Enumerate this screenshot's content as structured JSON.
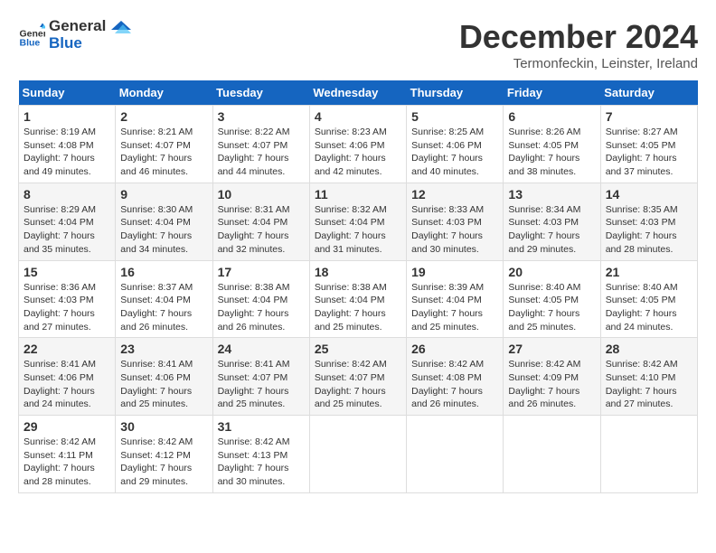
{
  "logo": {
    "general": "General",
    "blue": "Blue"
  },
  "title": "December 2024",
  "location": "Termonfeckin, Leinster, Ireland",
  "days_of_week": [
    "Sunday",
    "Monday",
    "Tuesday",
    "Wednesday",
    "Thursday",
    "Friday",
    "Saturday"
  ],
  "weeks": [
    [
      {
        "day": "1",
        "sunrise": "8:19 AM",
        "sunset": "4:08 PM",
        "daylight": "7 hours and 49 minutes."
      },
      {
        "day": "2",
        "sunrise": "8:21 AM",
        "sunset": "4:07 PM",
        "daylight": "7 hours and 46 minutes."
      },
      {
        "day": "3",
        "sunrise": "8:22 AM",
        "sunset": "4:07 PM",
        "daylight": "7 hours and 44 minutes."
      },
      {
        "day": "4",
        "sunrise": "8:23 AM",
        "sunset": "4:06 PM",
        "daylight": "7 hours and 42 minutes."
      },
      {
        "day": "5",
        "sunrise": "8:25 AM",
        "sunset": "4:06 PM",
        "daylight": "7 hours and 40 minutes."
      },
      {
        "day": "6",
        "sunrise": "8:26 AM",
        "sunset": "4:05 PM",
        "daylight": "7 hours and 38 minutes."
      },
      {
        "day": "7",
        "sunrise": "8:27 AM",
        "sunset": "4:05 PM",
        "daylight": "7 hours and 37 minutes."
      }
    ],
    [
      {
        "day": "8",
        "sunrise": "8:29 AM",
        "sunset": "4:04 PM",
        "daylight": "7 hours and 35 minutes."
      },
      {
        "day": "9",
        "sunrise": "8:30 AM",
        "sunset": "4:04 PM",
        "daylight": "7 hours and 34 minutes."
      },
      {
        "day": "10",
        "sunrise": "8:31 AM",
        "sunset": "4:04 PM",
        "daylight": "7 hours and 32 minutes."
      },
      {
        "day": "11",
        "sunrise": "8:32 AM",
        "sunset": "4:04 PM",
        "daylight": "7 hours and 31 minutes."
      },
      {
        "day": "12",
        "sunrise": "8:33 AM",
        "sunset": "4:03 PM",
        "daylight": "7 hours and 30 minutes."
      },
      {
        "day": "13",
        "sunrise": "8:34 AM",
        "sunset": "4:03 PM",
        "daylight": "7 hours and 29 minutes."
      },
      {
        "day": "14",
        "sunrise": "8:35 AM",
        "sunset": "4:03 PM",
        "daylight": "7 hours and 28 minutes."
      }
    ],
    [
      {
        "day": "15",
        "sunrise": "8:36 AM",
        "sunset": "4:03 PM",
        "daylight": "7 hours and 27 minutes."
      },
      {
        "day": "16",
        "sunrise": "8:37 AM",
        "sunset": "4:04 PM",
        "daylight": "7 hours and 26 minutes."
      },
      {
        "day": "17",
        "sunrise": "8:38 AM",
        "sunset": "4:04 PM",
        "daylight": "7 hours and 26 minutes."
      },
      {
        "day": "18",
        "sunrise": "8:38 AM",
        "sunset": "4:04 PM",
        "daylight": "7 hours and 25 minutes."
      },
      {
        "day": "19",
        "sunrise": "8:39 AM",
        "sunset": "4:04 PM",
        "daylight": "7 hours and 25 minutes."
      },
      {
        "day": "20",
        "sunrise": "8:40 AM",
        "sunset": "4:05 PM",
        "daylight": "7 hours and 25 minutes."
      },
      {
        "day": "21",
        "sunrise": "8:40 AM",
        "sunset": "4:05 PM",
        "daylight": "7 hours and 24 minutes."
      }
    ],
    [
      {
        "day": "22",
        "sunrise": "8:41 AM",
        "sunset": "4:06 PM",
        "daylight": "7 hours and 24 minutes."
      },
      {
        "day": "23",
        "sunrise": "8:41 AM",
        "sunset": "4:06 PM",
        "daylight": "7 hours and 25 minutes."
      },
      {
        "day": "24",
        "sunrise": "8:41 AM",
        "sunset": "4:07 PM",
        "daylight": "7 hours and 25 minutes."
      },
      {
        "day": "25",
        "sunrise": "8:42 AM",
        "sunset": "4:07 PM",
        "daylight": "7 hours and 25 minutes."
      },
      {
        "day": "26",
        "sunrise": "8:42 AM",
        "sunset": "4:08 PM",
        "daylight": "7 hours and 26 minutes."
      },
      {
        "day": "27",
        "sunrise": "8:42 AM",
        "sunset": "4:09 PM",
        "daylight": "7 hours and 26 minutes."
      },
      {
        "day": "28",
        "sunrise": "8:42 AM",
        "sunset": "4:10 PM",
        "daylight": "7 hours and 27 minutes."
      }
    ],
    [
      {
        "day": "29",
        "sunrise": "8:42 AM",
        "sunset": "4:11 PM",
        "daylight": "7 hours and 28 minutes."
      },
      {
        "day": "30",
        "sunrise": "8:42 AM",
        "sunset": "4:12 PM",
        "daylight": "7 hours and 29 minutes."
      },
      {
        "day": "31",
        "sunrise": "8:42 AM",
        "sunset": "4:13 PM",
        "daylight": "7 hours and 30 minutes."
      },
      null,
      null,
      null,
      null
    ]
  ]
}
